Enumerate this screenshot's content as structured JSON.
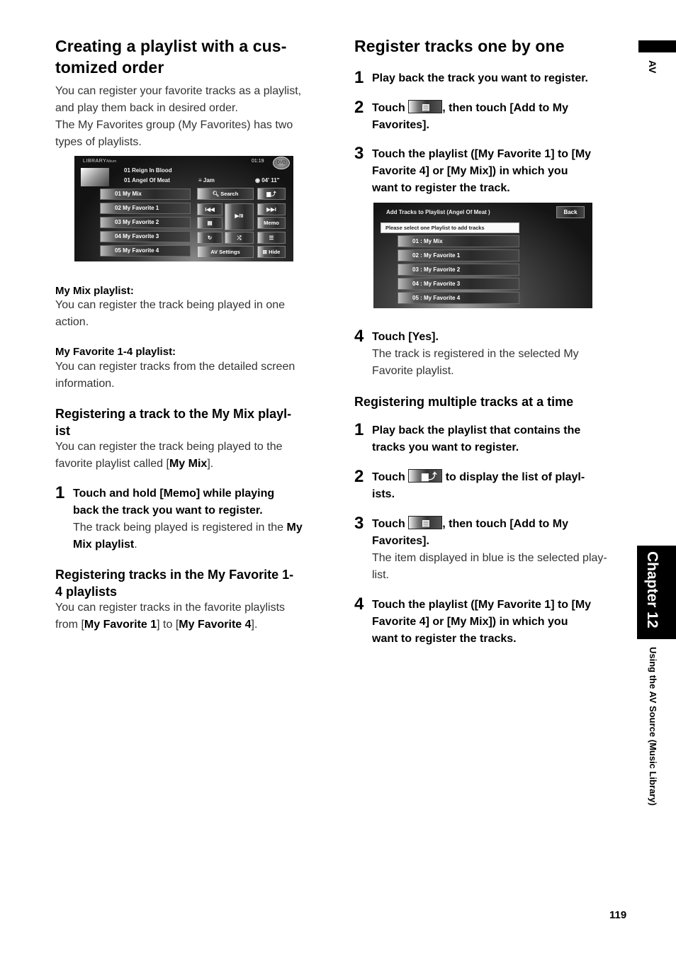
{
  "left": {
    "title": "Creating a playlist with a customized order",
    "title_line1": "Creating a playlist with a cus-",
    "title_line2": "tomized order",
    "intro_lines": [
      "You can register your favorite tracks as a playlist,",
      "and play them back in desired order.",
      "The My Favorites group (My Favorites) has two",
      "types of playlists."
    ],
    "screenshot1": {
      "header_label": "LIBRARY",
      "header_sub": "Album",
      "clock": "01:19",
      "now_playing": [
        {
          "num": "01",
          "text": "Reign In Blood"
        },
        {
          "num": "01",
          "text": "Angel Of Meat"
        }
      ],
      "genre": "Jam",
      "time": "04' 11\"",
      "playlists": [
        "01 My Mix",
        "02 My Favorite 1",
        "03 My Favorite 2",
        "04 My Favorite 3",
        "05 My Favorite 4"
      ],
      "buttons": {
        "search": "Search",
        "prev": "I◀◀",
        "play_pause": "▶/II",
        "list": "▤",
        "next": "▶▶I",
        "memo": "Memo",
        "repeat": "↻",
        "shuffle": "⤮",
        "folder_up": "▆⤴",
        "menu": "☰",
        "av_settings": "AV Settings",
        "hide": "Hide"
      }
    },
    "my_mix_heading": "My Mix playlist:",
    "my_mix_lines": [
      "You can register the track being played in one",
      "action."
    ],
    "my_fav_heading": "My Favorite 1-4 playlist:",
    "my_fav_lines": [
      "You can register tracks from the detailed screen",
      "information."
    ],
    "reg_mix_heading_l1": "Registering a track to the My Mix playl-",
    "reg_mix_heading_l2": "ist",
    "reg_mix_line1": "You can register the track being played to the",
    "reg_mix_line2_pre": "favorite playlist called [",
    "reg_mix_line2_bold": "My Mix",
    "reg_mix_line2_post": "].",
    "reg_mix_step": {
      "number": "1",
      "text_l1": "Touch and hold [Memo] while playing",
      "text_l2": "back the track you want to register.",
      "note_l1_pre": "The track being played is registered in the ",
      "note_l1_bold": "My",
      "note_l2_bold": "Mix playlist",
      "note_l2_post": "."
    },
    "reg_fav_heading_l1": "Registering tracks in the My Favorite 1-",
    "reg_fav_heading_l2": "4 playlists",
    "reg_fav_line1": "You can register tracks in the favorite playlists",
    "reg_fav_line2": {
      "pre": "from [",
      "b1": "My Favorite 1",
      "mid": "] to [",
      "b2": "My Favorite 4",
      "post": "]."
    }
  },
  "right": {
    "title": "Register tracks one by one",
    "steps_one": [
      {
        "number": "1",
        "lines": [
          "Play back the track you want to register."
        ]
      },
      {
        "number": "2",
        "pre": "Touch ",
        "icon": "list-button-icon",
        "post": ", then touch [Add to My",
        "line2": "Favorites]."
      },
      {
        "number": "3",
        "lines": [
          "Touch the playlist ([My Favorite 1] to [My",
          "Favorite 4] or [My Mix]) in which you",
          "want to register the track."
        ]
      },
      {
        "number": "4",
        "lines": [
          "Touch [Yes]."
        ],
        "note": [
          "The track is registered in the selected My",
          "Favorite playlist."
        ]
      }
    ],
    "screenshot2": {
      "title": "Add Tracks to Playlist (Angel Of Meat )",
      "back": "Back",
      "prompt": "Please select one Playlist to add tracks",
      "playlists": [
        "01 : My Mix",
        "02 : My Favorite 1",
        "03 : My Favorite 2",
        "04 : My Favorite 3",
        "05 : My Favorite 4"
      ]
    },
    "multi_heading": "Registering multiple tracks at a time",
    "steps_multi": [
      {
        "number": "1",
        "lines": [
          "Play back the playlist that contains the",
          "tracks you want to register."
        ]
      },
      {
        "number": "2",
        "pre": "Touch ",
        "icon": "folder-up-button-icon",
        "post": " to display the list of playl-",
        "line2": "ists."
      },
      {
        "number": "3",
        "pre": "Touch ",
        "icon": "list-button-icon",
        "post": ", then touch [Add to My",
        "line2": "Favorites].",
        "note": [
          "The item displayed in blue is the selected play-",
          "list."
        ]
      },
      {
        "number": "4",
        "lines": [
          "Touch the playlist ([My Favorite 1] to [My",
          "Favorite 4] or [My Mix]) in which you",
          "want to register the tracks."
        ]
      }
    ]
  },
  "margin": {
    "av_tab": "AV",
    "chapter": "Chapter 12",
    "section": "Using the AV Source (Music Library)",
    "page_number": "119"
  }
}
